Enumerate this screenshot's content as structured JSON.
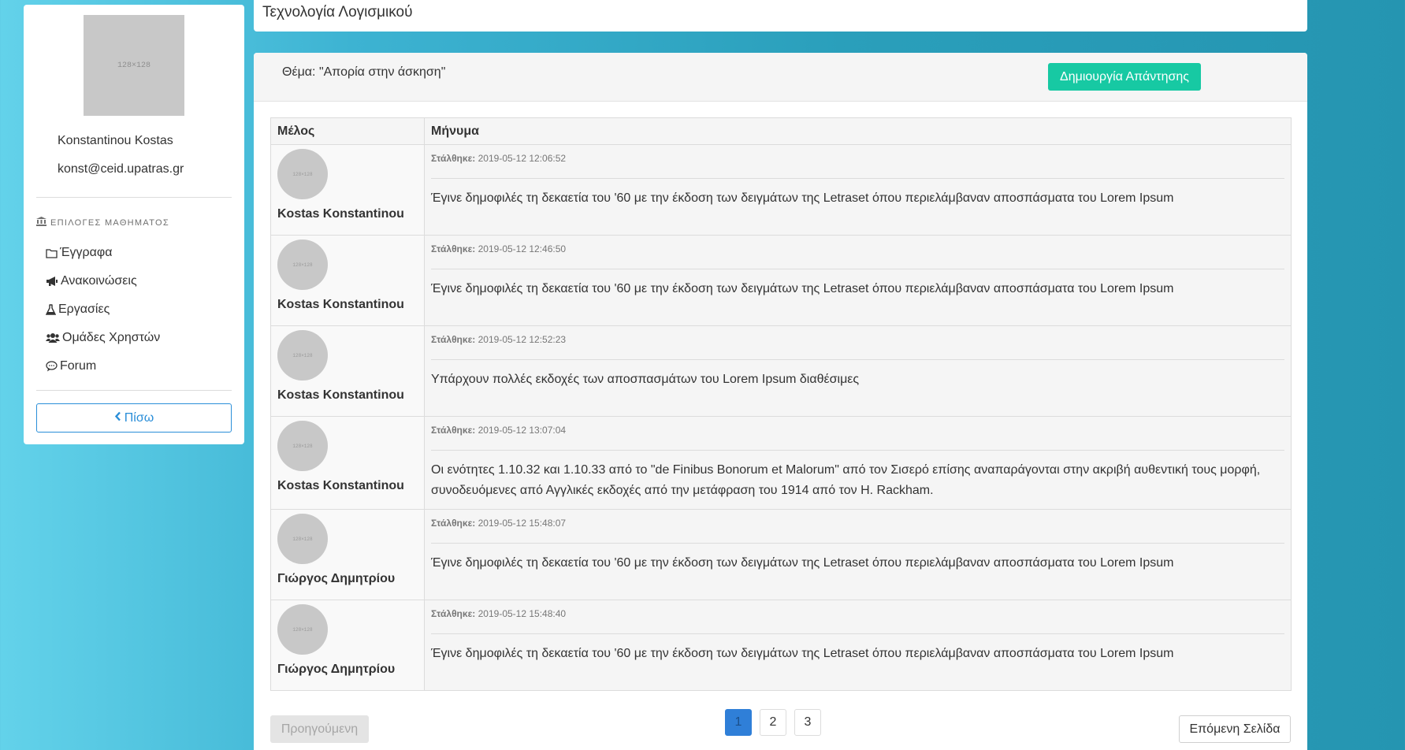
{
  "sidebar": {
    "avatar_placeholder": "128×128",
    "user_name": "Konstantinou Kostas",
    "user_email": "konst@ceid.upatras.gr",
    "menu_title": "ΕΠΙΛΟΓΕΣ ΜΑΘΗΜΑΤΟΣ",
    "items": [
      {
        "label": "Έγγραφα",
        "icon": "folder-icon"
      },
      {
        "label": "Ανακοινώσεις",
        "icon": "megaphone-icon"
      },
      {
        "label": "Εργασίες",
        "icon": "flask-icon"
      },
      {
        "label": "Ομάδες Χρηστών",
        "icon": "users-icon"
      },
      {
        "label": "Forum",
        "icon": "comment-icon"
      }
    ],
    "back_label": "Πίσω"
  },
  "topbar": {
    "title": "Τεχνολογία Λογισμικού"
  },
  "thread": {
    "topic": "Θέμα: \"Απορία στην άσκηση\"",
    "reply_button": "Δημιουργία Απάντησης",
    "columns": [
      "Μέλος",
      "Μήνυμα"
    ],
    "sent_label": "Στάλθηκε:",
    "avatar_placeholder": "128×128",
    "posts": [
      {
        "author": "Kostas Konstantinou",
        "sent": "2019-05-12 12:06:52",
        "text": "Έγινε δημοφιλές τη δεκαετία του '60 με την έκδοση των δειγμάτων της Letraset όπου περιελάμβαναν αποσπάσματα του Lorem Ipsum"
      },
      {
        "author": "Kostas Konstantinou",
        "sent": "2019-05-12 12:46:50",
        "text": "Έγινε δημοφιλές τη δεκαετία του '60 με την έκδοση των δειγμάτων της Letraset όπου περιελάμβαναν αποσπάσματα του Lorem Ipsum"
      },
      {
        "author": "Kostas Konstantinou",
        "sent": "2019-05-12 12:52:23",
        "text": "Υπάρχουν πολλές εκδοχές των αποσπασμάτων του Lorem Ipsum διαθέσιμες"
      },
      {
        "author": "Kostas Konstantinou",
        "sent": "2019-05-12 13:07:04",
        "text": "Οι ενότητες 1.10.32 και 1.10.33 από το \"de Finibus Bonorum et Malorum\" από τον Σισερό επίσης αναπαράγονται στην ακριβή αυθεντική τους μορφή, συνοδευόμενες από Αγγλικές εκδοχές από την μετάφραση του 1914 από τον H. Rackham."
      },
      {
        "author": "Γιώργος Δημητρίου",
        "sent": "2019-05-12 15:48:07",
        "text": "Έγινε δημοφιλές τη δεκαετία του '60 με την έκδοση των δειγμάτων της Letraset όπου περιελάμβαναν αποσπάσματα του Lorem Ipsum"
      },
      {
        "author": "Γιώργος Δημητρίου",
        "sent": "2019-05-12 15:48:40",
        "text": "Έγινε δημοφιλές τη δεκαετία του '60 με την έκδοση των δειγμάτων της Letraset όπου περιελάμβαναν αποσπάσματα του Lorem Ipsum"
      }
    ]
  },
  "pagination": {
    "prev_label": "Προηγούμενη",
    "pages": [
      "1",
      "2",
      "3"
    ],
    "current_page": "1",
    "next_label": "Επόμενη Σελίδα"
  },
  "colors": {
    "accent_teal": "#17c9a3",
    "link_blue": "#2a8ed8",
    "active_page": "#2f7fd8"
  }
}
